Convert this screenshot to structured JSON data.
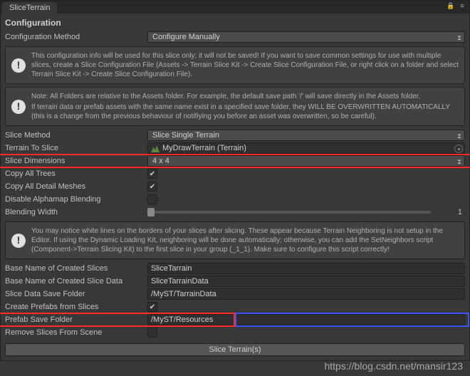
{
  "tab": {
    "title": "SliceTerrain"
  },
  "header": {
    "title": "Configuration"
  },
  "configMethod": {
    "label": "Configuration Method",
    "value": "Configure Manually"
  },
  "info1": {
    "text": "This configuration info will be used for this slice only; it will not be saved! If you want to save common settings for use with multiple slices, create a Slice Configuration File (Assets -> Terrain Slice Kit -> Create Slice Configuration File, or right click on a folder and select Terrain Slice Kit -> Create Slice Configuration File)."
  },
  "info2": {
    "p1": "Note: All Folders are relative to the Assets folder. For example, the default save path '/' will save directly in the Assets folder.",
    "p2": "If terrain data or prefab assets with the same name exist in a specified save folder, they WILL BE OVERWRITTEN AUTOMATICALLY (this is a change from the previous behaviour of notifiying you before an asset was overwritten, so be careful)."
  },
  "sliceMethod": {
    "label": "Slice Method",
    "value": "Slice Single Terrain"
  },
  "terrainToSlice": {
    "label": "Terrain To Slice",
    "value": "MyDrawTerrain (Terrain)"
  },
  "sliceDimensions": {
    "label": "Slice Dimensions",
    "value": "4 x 4"
  },
  "copyAllTrees": {
    "label": "Copy All Trees",
    "checked": true
  },
  "copyAllDetailMeshes": {
    "label": "Copy All Detail Meshes",
    "checked": true
  },
  "disableAlphamapBlending": {
    "label": "Disable Alphamap Blending",
    "checked": false
  },
  "blendingWidth": {
    "label": "Blending Width",
    "value": "1"
  },
  "info3": {
    "text": "You may notice white lines on the borders of your slices after slicing. These appear because Terrain Neighboring is not setup in the Editor. If using the Dynamic Loading Kit, neighboring will be done automatically; otherwise, you can add the SetNeighbors script (Component->Terrain Slicing Kit) to the first slice in your group (_1_1). Make sure to configure this script correctly!"
  },
  "baseNameSlices": {
    "label": "Base Name of Created Slices",
    "value": "SliceTarrain"
  },
  "baseNameSliceData": {
    "label": "Base Name of Created Slice Data",
    "value": "SliceTarrainData"
  },
  "sliceDataSaveFolder": {
    "label": "Slice Data Save Folder",
    "value": "/MyST/TarrainData"
  },
  "createPrefabs": {
    "label": "Create Prefabs from Slices",
    "checked": true
  },
  "prefabSaveFolder": {
    "label": "Prefab Save Folder",
    "value": "/MyST/Resources"
  },
  "removeSlices": {
    "label": "Remove Slices From Scene",
    "checked": false
  },
  "button": {
    "label": "Slice Terrain(s)"
  },
  "watermark": "https://blog.csdn.net/mansir123"
}
